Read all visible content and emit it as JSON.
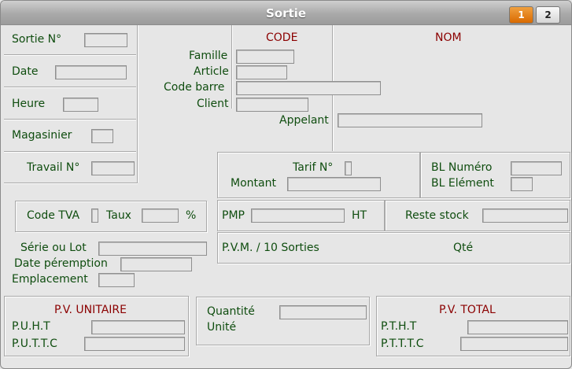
{
  "window": {
    "title": "Sortie",
    "tab1": "1",
    "tab2": "2"
  },
  "left": {
    "sortie_no": "Sortie N°",
    "date": "Date",
    "heure": "Heure",
    "magasinier": "Magasinier",
    "travail_no": "Travail N°"
  },
  "top": {
    "code_header": "CODE",
    "nom_header": "NOM",
    "famille": "Famille",
    "article": "Article",
    "code_barre": "Code barre",
    "client": "Client",
    "appelant": "Appelant"
  },
  "tarif": {
    "tarif_no": "Tarif N°",
    "montant": "Montant",
    "bl_numero": "BL Numéro",
    "bl_element": "BL Elément"
  },
  "tva": {
    "code_tva": "Code TVA",
    "taux": "Taux",
    "percent": "%"
  },
  "pmp": {
    "pmp": "PMP",
    "ht": "HT",
    "reste_stock": "Reste stock"
  },
  "pvm": {
    "label": "P.V.M. / 10 Sorties",
    "qte": "Qté"
  },
  "lot": {
    "serie_lot": "Série ou Lot",
    "date_peremption": "Date péremption",
    "emplacement": "Emplacement"
  },
  "pv_unitaire": {
    "header": "P.V. UNITAIRE",
    "puht": "P.U.H.T",
    "puttc": "P.U.T.T.C"
  },
  "quantite": {
    "quantite": "Quantité",
    "unite": "Unité"
  },
  "pv_total": {
    "header": "P.V. TOTAL",
    "ptht": "P.T.H.T",
    "ptttc": "P.T.T.T.C"
  }
}
